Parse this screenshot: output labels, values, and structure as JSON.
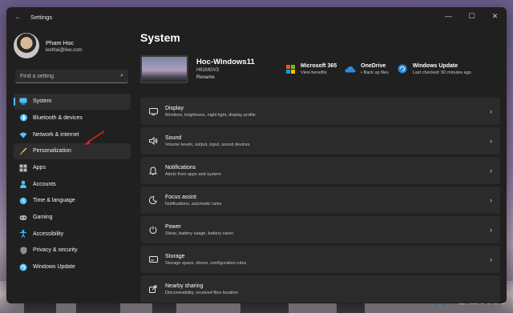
{
  "window": {
    "title": "Settings",
    "controls": [
      "—",
      "☐",
      "✕"
    ]
  },
  "profile": {
    "name": "Pham Hoc",
    "email": "lexthai@live.com"
  },
  "search": {
    "placeholder": "Find a setting"
  },
  "sidebar": {
    "items": [
      {
        "label": "System",
        "icon": "monitor-icon",
        "color": "#4cc2ff"
      },
      {
        "label": "Bluetooth & devices",
        "icon": "bluetooth-icon",
        "color": "#4cc2ff"
      },
      {
        "label": "Network & internet",
        "icon": "wifi-icon",
        "color": "#4cc2ff"
      },
      {
        "label": "Personalization",
        "icon": "brush-icon",
        "color": "#e8a06a"
      },
      {
        "label": "Apps",
        "icon": "apps-icon",
        "color": "#b0b0b0"
      },
      {
        "label": "Accounts",
        "icon": "person-icon",
        "color": "#4cc2ff"
      },
      {
        "label": "Time & language",
        "icon": "globe-clock-icon",
        "color": "#4cc2ff"
      },
      {
        "label": "Gaming",
        "icon": "gamepad-icon",
        "color": "#b0b0b0"
      },
      {
        "label": "Accessibility",
        "icon": "accessibility-icon",
        "color": "#4cc2ff"
      },
      {
        "label": "Privacy & security",
        "icon": "shield-icon",
        "color": "#a0a0a0"
      },
      {
        "label": "Windows Update",
        "icon": "update-icon",
        "color": "#4cc2ff"
      }
    ]
  },
  "main": {
    "title": "System",
    "device": {
      "name": "Hoc-Windows11",
      "model": "H61MGV3",
      "rename": "Rename"
    },
    "quick": [
      {
        "title": "Microsoft 365",
        "sub": "View benefits",
        "icon": "microsoft-icon"
      },
      {
        "title": "OneDrive",
        "sub": "• Back up files",
        "icon": "cloud-icon"
      },
      {
        "title": "Windows Update",
        "sub": "Last checked: 50 minutes ago",
        "icon": "update-icon"
      }
    ],
    "cards": [
      {
        "title": "Display",
        "sub": "Monitors, brightness, night light, display profile",
        "icon": "display-icon"
      },
      {
        "title": "Sound",
        "sub": "Volume levels, output, input, sound devices",
        "icon": "speaker-icon"
      },
      {
        "title": "Notifications",
        "sub": "Alerts from apps and system",
        "icon": "bell-icon"
      },
      {
        "title": "Focus assist",
        "sub": "Notifications, automatic rules",
        "icon": "moon-icon"
      },
      {
        "title": "Power",
        "sub": "Sleep, battery usage, battery saver",
        "icon": "power-icon"
      },
      {
        "title": "Storage",
        "sub": "Storage space, drives, configuration rules",
        "icon": "storage-icon"
      },
      {
        "title": "Nearby sharing",
        "sub": "Discoverability, received files location",
        "icon": "share-icon"
      }
    ]
  },
  "watermark": "GENK"
}
